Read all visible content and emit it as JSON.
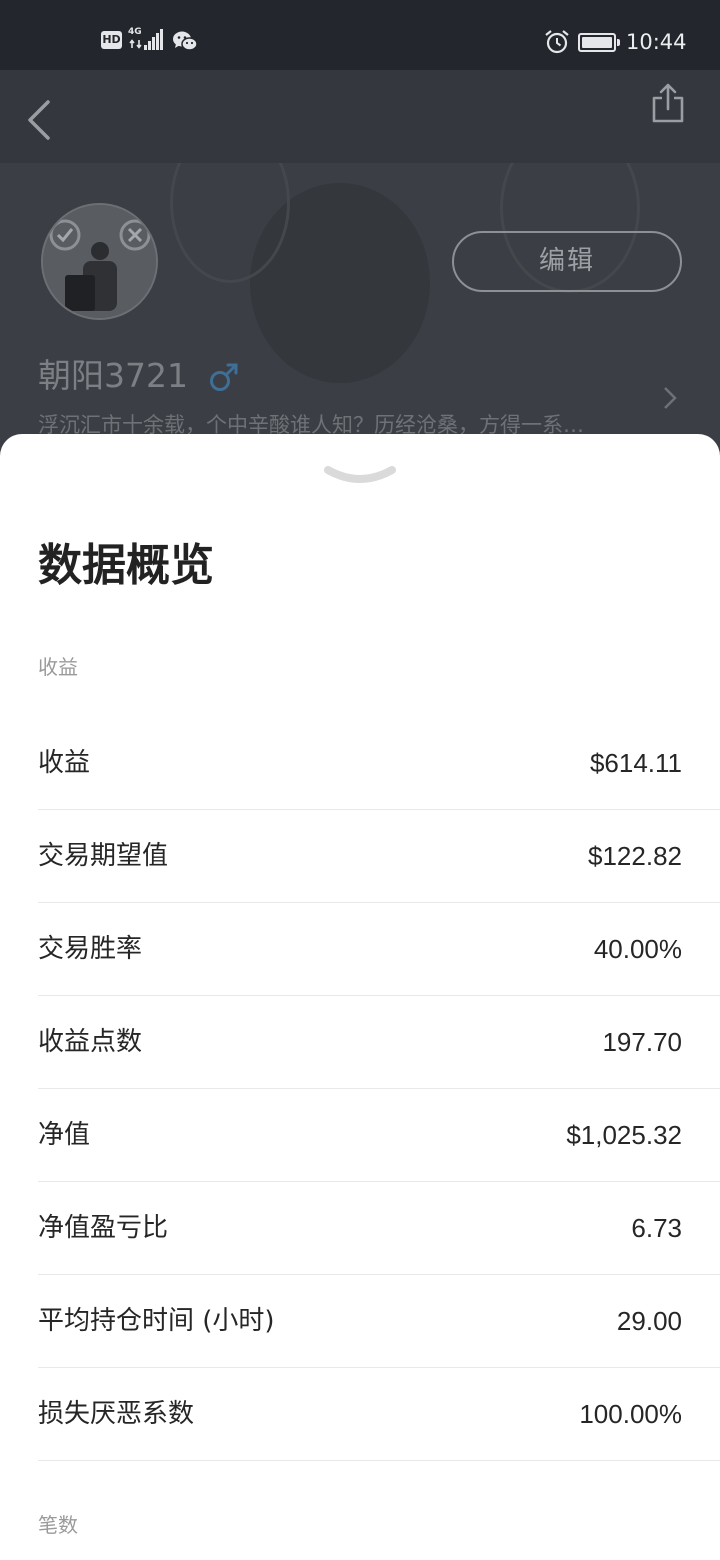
{
  "status_bar": {
    "hd_label": "HD",
    "network_type": "4G",
    "time": "10:44",
    "battery_level": 1.0
  },
  "profile": {
    "edit_label": "编辑",
    "username": "朝阳3721",
    "gender_symbol": "♂",
    "gender_color": "#3e6f96",
    "bio": "浮沉汇市十余载，个中辛酸谁人知？历经沧桑，方得一系…"
  },
  "overview": {
    "title": "数据概览",
    "section_earnings": "收益",
    "section_trades": "笔数",
    "rows": [
      {
        "label": "收益",
        "value": "$614.11"
      },
      {
        "label": "交易期望值",
        "value": "$122.82"
      },
      {
        "label": "交易胜率",
        "value": "40.00%"
      },
      {
        "label": "收益点数",
        "value": "197.70"
      },
      {
        "label": "净值",
        "value": "$1,025.32"
      },
      {
        "label": "净值盈亏比",
        "value": "6.73"
      },
      {
        "label": "平均持仓时间 (小时)",
        "value": "29.00"
      },
      {
        "label": "损失厌恶系数",
        "value": "100.00%"
      }
    ]
  }
}
